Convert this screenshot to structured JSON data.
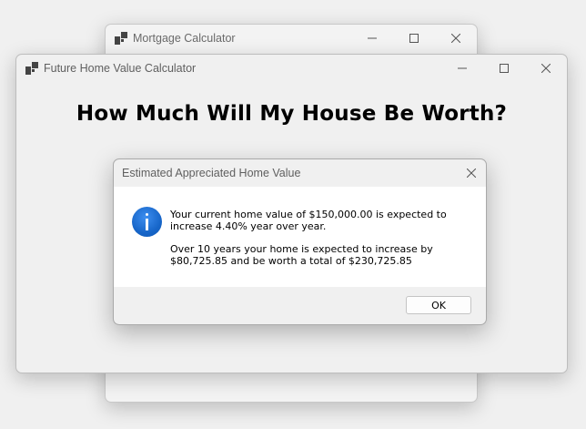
{
  "mortgage_window": {
    "title": "Mortgage Calculator"
  },
  "future_window": {
    "title": "Future Home Value Calculator",
    "heading": "How Much Will My House Be Worth?"
  },
  "message_dialog": {
    "title": "Estimated Appreciated Home Value",
    "message_line1": "Your current home value of $150,000.00 is expected to increase 4.40% year over year.",
    "message_line2": "Over 10 years your home is expected to increase by $80,725.85 and be worth a total of $230,725.85",
    "ok_label": "OK",
    "icon": "info-icon"
  },
  "colors": {
    "info_blue": "#1766c9",
    "window_bg": "#f0f0f0",
    "dialog_body_bg": "#ffffff"
  }
}
